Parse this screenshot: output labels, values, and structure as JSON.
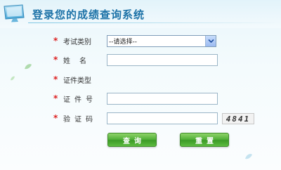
{
  "header": {
    "title": "登录您的成绩查询系统"
  },
  "form": {
    "exam_type": {
      "label": "考试类别",
      "selected": "--请选择--"
    },
    "name": {
      "label": "姓名",
      "value": ""
    },
    "id_type": {
      "label": "证件类型"
    },
    "id_number": {
      "label": "证件号",
      "value": ""
    },
    "verify_code": {
      "label": "验证码",
      "value": "",
      "captcha": "4841"
    }
  },
  "buttons": {
    "query": "查询",
    "reset": "重置"
  },
  "colors": {
    "accent": "#1e73a8",
    "required": "#dd2222",
    "button": "#4caf35"
  }
}
